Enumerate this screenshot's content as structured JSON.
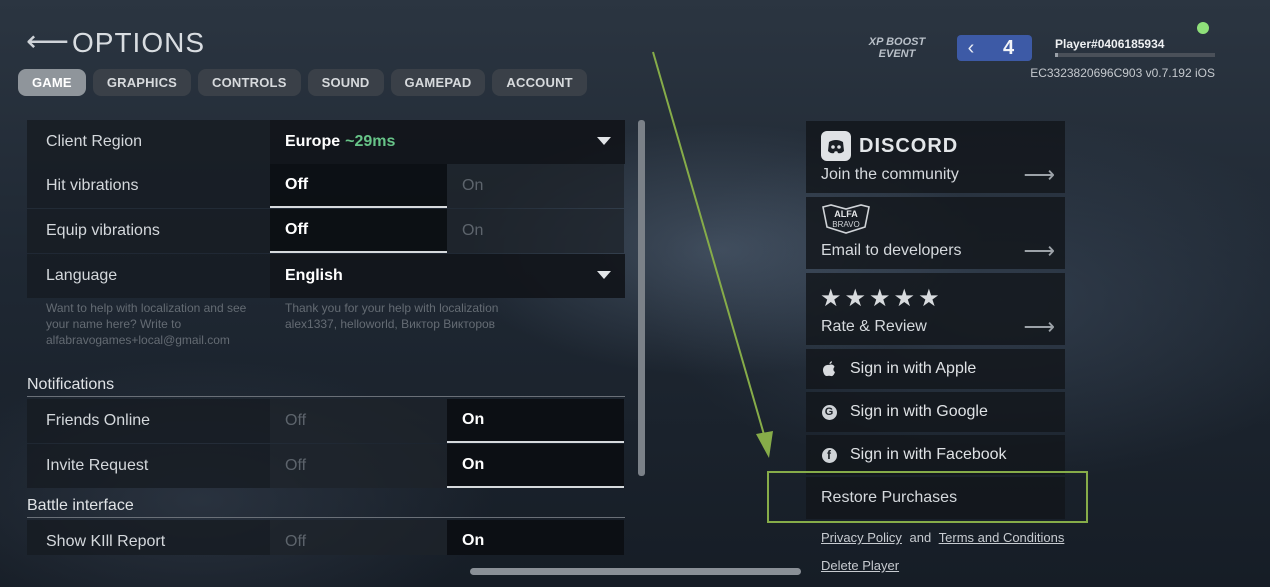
{
  "header": {
    "back_arrow": "⟵",
    "title": "OPTIONS",
    "tabs": [
      "GAME",
      "GRAPHICS",
      "CONTROLS",
      "SOUND",
      "GAMEPAD",
      "ACCOUNT"
    ],
    "active_tab": "GAME"
  },
  "player": {
    "event_badge": "XP BOOST EVENT",
    "level": "4",
    "name": "Player#0406185934",
    "build": "EC3323820696C903 v0.7.192 iOS",
    "xp_progress": 0.02,
    "online_color": "#8fe07a"
  },
  "settings": {
    "client_region": {
      "label": "Client Region",
      "value": "Europe",
      "ping": "~29ms"
    },
    "hit_vibrations": {
      "label": "Hit vibrations",
      "off": "Off",
      "on": "On",
      "selected": "Off"
    },
    "equip_vibrations": {
      "label": "Equip vibrations",
      "off": "Off",
      "on": "On",
      "selected": "Off"
    },
    "language": {
      "label": "Language",
      "value": "English",
      "help_left": "Want to help with localization and see your name here? Write to alfabravogames+local@gmail.com",
      "help_right": "Thank you for your help with localization alex1337, helloworld, Виктор Викторов"
    },
    "notifications_header": "Notifications",
    "friends_online": {
      "label": "Friends Online",
      "off": "Off",
      "on": "On",
      "selected": "On"
    },
    "invite_request": {
      "label": "Invite Request",
      "off": "Off",
      "on": "On",
      "selected": "On"
    },
    "battle_header": "Battle interface",
    "show_kill_report": {
      "label": "Show KIll Report",
      "off": "Off",
      "on": "On",
      "selected": "On"
    }
  },
  "side": {
    "discord": {
      "word": "DISCORD",
      "caption": "Join the community",
      "icon": "discord-icon"
    },
    "email": {
      "logo_top": "ALFA",
      "logo_bottom": "BRAVO",
      "caption": "Email to developers"
    },
    "rate": {
      "stars": "★★★★★",
      "caption": "Rate & Review"
    },
    "arrow": "⟶",
    "sign_apple": "Sign in with Apple",
    "sign_google": "Sign in with Google",
    "sign_facebook": "Sign in with Facebook",
    "restore": "Restore Purchases",
    "privacy": "Privacy Policy",
    "and": "and",
    "terms": "Terms and Conditions",
    "delete": "Delete Player"
  },
  "colors": {
    "accent_highlight": "#86ac49",
    "ping_green": "#67c488",
    "level_badge": "#3d5aa6"
  }
}
